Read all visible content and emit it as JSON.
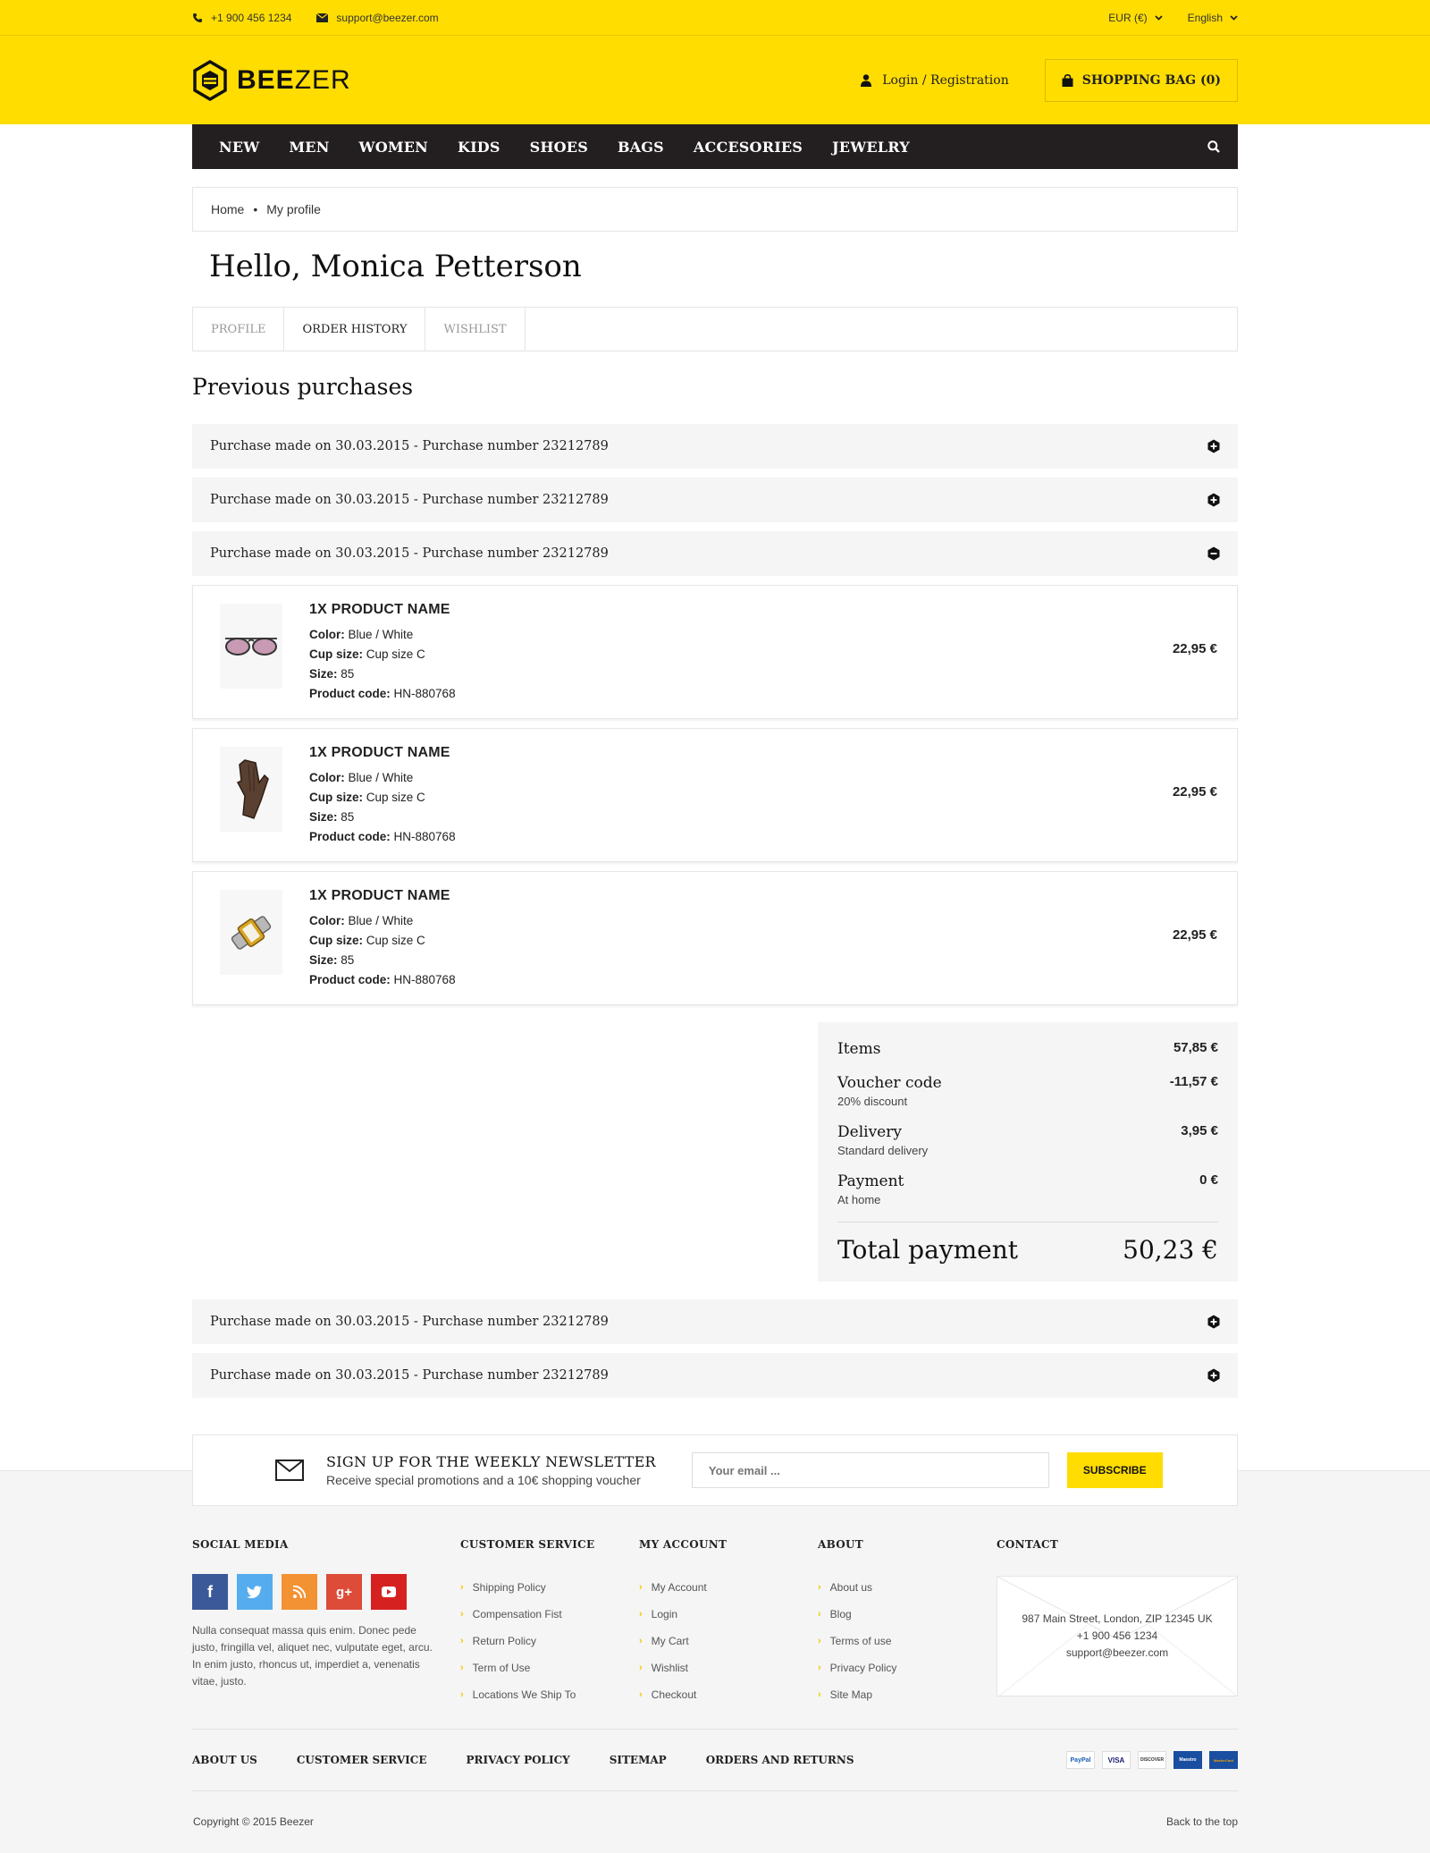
{
  "topbar": {
    "phone": "+1 900 456 1234",
    "email": "support@beezer.com",
    "currency": "EUR (€)",
    "language": "English"
  },
  "header": {
    "logo_bold": "BEE",
    "logo_light": "ZER",
    "login": "Login / Registration",
    "bag": "SHOPPING BAG (0)"
  },
  "nav": [
    "NEW",
    "MEN",
    "WOMEN",
    "KIDS",
    "SHOES",
    "BAGS",
    "ACCESORIES",
    "JEWELRY"
  ],
  "breadcrumb": {
    "home": "Home",
    "current": "My profile"
  },
  "greeting": "Hello, Monica Petterson",
  "tabs": [
    {
      "label": "PROFILE"
    },
    {
      "label": "ORDER HISTORY"
    },
    {
      "label": "WISHLIST"
    }
  ],
  "section_title": "Previous purchases",
  "purchase_label": "Purchase made on 30.03.2015 - Purchase number 23212789",
  "items": [
    {
      "name": "1X PRODUCT NAME",
      "color_label": "Color:",
      "color": "Blue / White",
      "cup_label": "Cup size:",
      "cup": "Cup size C",
      "size_label": "Size:",
      "size": "85",
      "code_label": "Product code:",
      "code": "HN-880768",
      "price": "22,95 €",
      "image": "sunglasses-image"
    },
    {
      "name": "1X PRODUCT NAME",
      "color_label": "Color:",
      "color": "Blue / White",
      "cup_label": "Cup size:",
      "cup": "Cup size C",
      "size_label": "Size:",
      "size": "85",
      "code_label": "Product code:",
      "code": "HN-880768",
      "price": "22,95 €",
      "image": "gloves-image"
    },
    {
      "name": "1X PRODUCT NAME",
      "color_label": "Color:",
      "color": "Blue / White",
      "cup_label": "Cup size:",
      "cup": "Cup size C",
      "size_label": "Size:",
      "size": "85",
      "code_label": "Product code:",
      "code": "HN-880768",
      "price": "22,95 €",
      "image": "watch-image"
    }
  ],
  "summary": {
    "items_label": "Items",
    "items_value": "57,85 €",
    "voucher_label": "Voucher code",
    "voucher_sub": "20% discount",
    "voucher_value": "-11,57 €",
    "delivery_label": "Delivery",
    "delivery_sub": "Standard delivery",
    "delivery_value": "3,95 €",
    "payment_label": "Payment",
    "payment_sub": "At home",
    "payment_value": "0 €",
    "total_label": "Total payment",
    "total_value": "50,23 €"
  },
  "newsletter": {
    "title": "SIGN UP FOR THE WEEKLY NEWSLETTER",
    "subtitle": "Receive special promotions and a 10€ shopping voucher",
    "placeholder": "Your email ...",
    "button": "SUBSCRIBE"
  },
  "footer": {
    "social_title": "SOCIAL MEDIA",
    "about_text": "Nulla consequat massa quis enim. Donec pede justo, fringilla vel, aliquet nec, vulputate eget, arcu. In enim justo, rhoncus ut, imperdiet a, venenatis vitae, justo.",
    "customer_title": "CUSTOMER SERVICE",
    "customer_links": [
      "Shipping Policy",
      "Compensation Fist",
      "Return Policy",
      "Term of Use",
      "Locations We Ship To"
    ],
    "account_title": "MY ACCOUNT",
    "account_links": [
      "My Account",
      "Login",
      "My Cart",
      "Wishlist",
      "Checkout"
    ],
    "about_title": "ABOUT",
    "about_links": [
      "About us",
      "Blog",
      "Terms of use",
      "Privacy Policy",
      "Site Map"
    ],
    "contact_title": "CONTACT",
    "contact_address": "987 Main Street, London, ZIP 12345 UK",
    "contact_phone": "+1 900 456 1234",
    "contact_email": "support@beezer.com",
    "bottom_nav": [
      "ABOUT US",
      "CUSTOMER SERVICE",
      "PRIVACY POLICY",
      "SITEMAP",
      "ORDERS AND RETURNS"
    ],
    "payments": [
      "PayPal",
      "VISA",
      "DISCOVER",
      "Maestro",
      "MasterCard"
    ],
    "copyright": "Copyright © 2015 Beezer",
    "back_to_top": "Back to the top"
  },
  "colors": {
    "accent": "#ffdd00",
    "nav_bg": "#231f20",
    "panel_bg": "#f5f5f5",
    "facebook": "#3b5998",
    "twitter": "#55acee",
    "rss": "#f39233",
    "google": "#dd4b39",
    "youtube": "#d62121"
  }
}
